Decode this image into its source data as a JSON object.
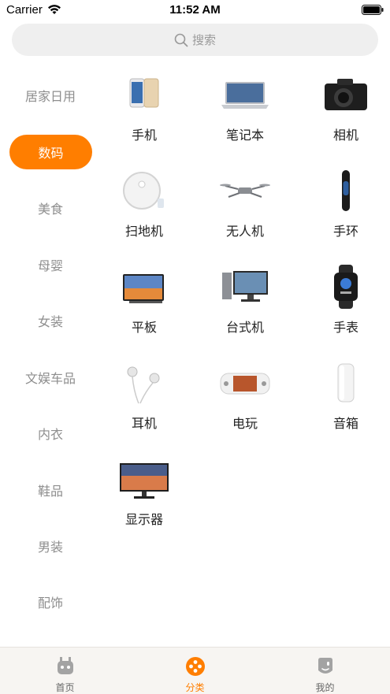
{
  "status_bar": {
    "carrier": "Carrier",
    "time": "11:52 AM"
  },
  "search": {
    "placeholder": "搜索"
  },
  "sidebar": {
    "active_color": "#ff7e00",
    "items": [
      {
        "label": "居家日用"
      },
      {
        "label": "数码",
        "active": true
      },
      {
        "label": "美食"
      },
      {
        "label": "母婴"
      },
      {
        "label": "女装"
      },
      {
        "label": "文娱车品"
      },
      {
        "label": "内衣"
      },
      {
        "label": "鞋品"
      },
      {
        "label": "男装"
      },
      {
        "label": "配饰"
      }
    ]
  },
  "grid": {
    "items": [
      {
        "label": "手机",
        "icon": "phone-icon"
      },
      {
        "label": "笔记本",
        "icon": "laptop-icon"
      },
      {
        "label": "相机",
        "icon": "camera-icon"
      },
      {
        "label": "扫地机",
        "icon": "robot-vacuum-icon"
      },
      {
        "label": "无人机",
        "icon": "drone-icon"
      },
      {
        "label": "手环",
        "icon": "fitness-band-icon"
      },
      {
        "label": "平板",
        "icon": "tablet-icon"
      },
      {
        "label": "台式机",
        "icon": "desktop-icon"
      },
      {
        "label": "手表",
        "icon": "smartwatch-icon"
      },
      {
        "label": "耳机",
        "icon": "earphones-icon"
      },
      {
        "label": "电玩",
        "icon": "game-console-icon"
      },
      {
        "label": "音箱",
        "icon": "speaker-icon"
      },
      {
        "label": "显示器",
        "icon": "monitor-icon"
      }
    ]
  },
  "tabbar": {
    "tabs": [
      {
        "label": "首页",
        "icon": "home-robot-icon"
      },
      {
        "label": "分类",
        "icon": "category-icon",
        "active": true
      },
      {
        "label": "我的",
        "icon": "profile-icon"
      }
    ]
  }
}
